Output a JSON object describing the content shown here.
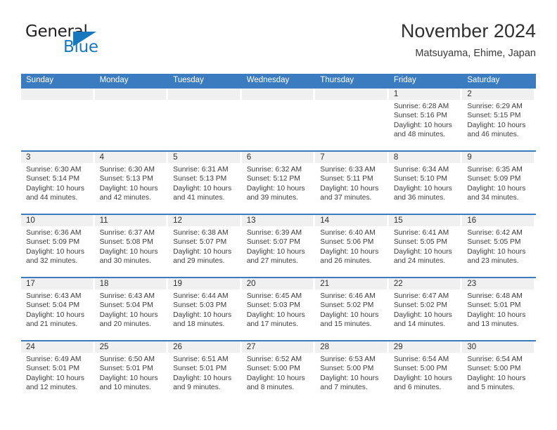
{
  "brand": {
    "name_part1": "General",
    "name_part2": "Blue",
    "accent_color": "#1878be",
    "triangle_icon": "triangle-icon"
  },
  "header": {
    "month_title": "November 2024",
    "location": "Matsuyama, Ehime, Japan"
  },
  "theme": {
    "header_blue": "#3b7cc0",
    "daynum_band": "#f0f0f0",
    "text": "#3c3c3c"
  },
  "calendar": {
    "weekday_headers": [
      "Sunday",
      "Monday",
      "Tuesday",
      "Wednesday",
      "Thursday",
      "Friday",
      "Saturday"
    ],
    "weeks": [
      [
        {
          "day": "",
          "empty": true
        },
        {
          "day": "",
          "empty": true
        },
        {
          "day": "",
          "empty": true
        },
        {
          "day": "",
          "empty": true
        },
        {
          "day": "",
          "empty": true
        },
        {
          "day": "1",
          "sunrise": "Sunrise: 6:28 AM",
          "sunset": "Sunset: 5:16 PM",
          "daylight1": "Daylight: 10 hours",
          "daylight2": "and 48 minutes."
        },
        {
          "day": "2",
          "sunrise": "Sunrise: 6:29 AM",
          "sunset": "Sunset: 5:15 PM",
          "daylight1": "Daylight: 10 hours",
          "daylight2": "and 46 minutes."
        }
      ],
      [
        {
          "day": "3",
          "sunrise": "Sunrise: 6:30 AM",
          "sunset": "Sunset: 5:14 PM",
          "daylight1": "Daylight: 10 hours",
          "daylight2": "and 44 minutes."
        },
        {
          "day": "4",
          "sunrise": "Sunrise: 6:30 AM",
          "sunset": "Sunset: 5:13 PM",
          "daylight1": "Daylight: 10 hours",
          "daylight2": "and 42 minutes."
        },
        {
          "day": "5",
          "sunrise": "Sunrise: 6:31 AM",
          "sunset": "Sunset: 5:13 PM",
          "daylight1": "Daylight: 10 hours",
          "daylight2": "and 41 minutes."
        },
        {
          "day": "6",
          "sunrise": "Sunrise: 6:32 AM",
          "sunset": "Sunset: 5:12 PM",
          "daylight1": "Daylight: 10 hours",
          "daylight2": "and 39 minutes."
        },
        {
          "day": "7",
          "sunrise": "Sunrise: 6:33 AM",
          "sunset": "Sunset: 5:11 PM",
          "daylight1": "Daylight: 10 hours",
          "daylight2": "and 37 minutes."
        },
        {
          "day": "8",
          "sunrise": "Sunrise: 6:34 AM",
          "sunset": "Sunset: 5:10 PM",
          "daylight1": "Daylight: 10 hours",
          "daylight2": "and 36 minutes."
        },
        {
          "day": "9",
          "sunrise": "Sunrise: 6:35 AM",
          "sunset": "Sunset: 5:09 PM",
          "daylight1": "Daylight: 10 hours",
          "daylight2": "and 34 minutes."
        }
      ],
      [
        {
          "day": "10",
          "sunrise": "Sunrise: 6:36 AM",
          "sunset": "Sunset: 5:09 PM",
          "daylight1": "Daylight: 10 hours",
          "daylight2": "and 32 minutes."
        },
        {
          "day": "11",
          "sunrise": "Sunrise: 6:37 AM",
          "sunset": "Sunset: 5:08 PM",
          "daylight1": "Daylight: 10 hours",
          "daylight2": "and 30 minutes."
        },
        {
          "day": "12",
          "sunrise": "Sunrise: 6:38 AM",
          "sunset": "Sunset: 5:07 PM",
          "daylight1": "Daylight: 10 hours",
          "daylight2": "and 29 minutes."
        },
        {
          "day": "13",
          "sunrise": "Sunrise: 6:39 AM",
          "sunset": "Sunset: 5:07 PM",
          "daylight1": "Daylight: 10 hours",
          "daylight2": "and 27 minutes."
        },
        {
          "day": "14",
          "sunrise": "Sunrise: 6:40 AM",
          "sunset": "Sunset: 5:06 PM",
          "daylight1": "Daylight: 10 hours",
          "daylight2": "and 26 minutes."
        },
        {
          "day": "15",
          "sunrise": "Sunrise: 6:41 AM",
          "sunset": "Sunset: 5:05 PM",
          "daylight1": "Daylight: 10 hours",
          "daylight2": "and 24 minutes."
        },
        {
          "day": "16",
          "sunrise": "Sunrise: 6:42 AM",
          "sunset": "Sunset: 5:05 PM",
          "daylight1": "Daylight: 10 hours",
          "daylight2": "and 23 minutes."
        }
      ],
      [
        {
          "day": "17",
          "sunrise": "Sunrise: 6:43 AM",
          "sunset": "Sunset: 5:04 PM",
          "daylight1": "Daylight: 10 hours",
          "daylight2": "and 21 minutes."
        },
        {
          "day": "18",
          "sunrise": "Sunrise: 6:43 AM",
          "sunset": "Sunset: 5:04 PM",
          "daylight1": "Daylight: 10 hours",
          "daylight2": "and 20 minutes."
        },
        {
          "day": "19",
          "sunrise": "Sunrise: 6:44 AM",
          "sunset": "Sunset: 5:03 PM",
          "daylight1": "Daylight: 10 hours",
          "daylight2": "and 18 minutes."
        },
        {
          "day": "20",
          "sunrise": "Sunrise: 6:45 AM",
          "sunset": "Sunset: 5:03 PM",
          "daylight1": "Daylight: 10 hours",
          "daylight2": "and 17 minutes."
        },
        {
          "day": "21",
          "sunrise": "Sunrise: 6:46 AM",
          "sunset": "Sunset: 5:02 PM",
          "daylight1": "Daylight: 10 hours",
          "daylight2": "and 15 minutes."
        },
        {
          "day": "22",
          "sunrise": "Sunrise: 6:47 AM",
          "sunset": "Sunset: 5:02 PM",
          "daylight1": "Daylight: 10 hours",
          "daylight2": "and 14 minutes."
        },
        {
          "day": "23",
          "sunrise": "Sunrise: 6:48 AM",
          "sunset": "Sunset: 5:01 PM",
          "daylight1": "Daylight: 10 hours",
          "daylight2": "and 13 minutes."
        }
      ],
      [
        {
          "day": "24",
          "sunrise": "Sunrise: 6:49 AM",
          "sunset": "Sunset: 5:01 PM",
          "daylight1": "Daylight: 10 hours",
          "daylight2": "and 12 minutes."
        },
        {
          "day": "25",
          "sunrise": "Sunrise: 6:50 AM",
          "sunset": "Sunset: 5:01 PM",
          "daylight1": "Daylight: 10 hours",
          "daylight2": "and 10 minutes."
        },
        {
          "day": "26",
          "sunrise": "Sunrise: 6:51 AM",
          "sunset": "Sunset: 5:01 PM",
          "daylight1": "Daylight: 10 hours",
          "daylight2": "and 9 minutes."
        },
        {
          "day": "27",
          "sunrise": "Sunrise: 6:52 AM",
          "sunset": "Sunset: 5:00 PM",
          "daylight1": "Daylight: 10 hours",
          "daylight2": "and 8 minutes."
        },
        {
          "day": "28",
          "sunrise": "Sunrise: 6:53 AM",
          "sunset": "Sunset: 5:00 PM",
          "daylight1": "Daylight: 10 hours",
          "daylight2": "and 7 minutes."
        },
        {
          "day": "29",
          "sunrise": "Sunrise: 6:54 AM",
          "sunset": "Sunset: 5:00 PM",
          "daylight1": "Daylight: 10 hours",
          "daylight2": "and 6 minutes."
        },
        {
          "day": "30",
          "sunrise": "Sunrise: 6:54 AM",
          "sunset": "Sunset: 5:00 PM",
          "daylight1": "Daylight: 10 hours",
          "daylight2": "and 5 minutes."
        }
      ]
    ]
  }
}
